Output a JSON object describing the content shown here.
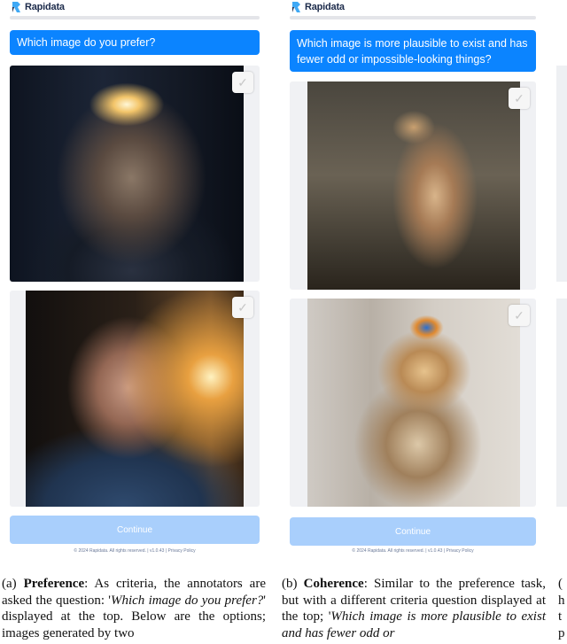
{
  "panel_a": {
    "logo_text": "Rapidata",
    "question": "Which image do you prefer?",
    "continue_label": "Continue",
    "footer": "© 2024 Rapidata. All rights reserved. | v1.0.43 | Privacy Policy"
  },
  "panel_b": {
    "logo_text": "Rapidata",
    "question": "Which image is more plausible to exist and has fewer odd or impossible-looking things?",
    "continue_label": "Continue",
    "footer": "© 2024 Rapidata. All rights reserved. | v1.0.43 | Privacy Policy"
  },
  "caption_a": {
    "label": "(a)",
    "title": "Preference",
    "text1": ": As criteria, the annotators are asked the question: '",
    "italic": "Which image do you prefer?",
    "text2": "' displayed at the top. Below are the options; images generated by two"
  },
  "caption_b": {
    "label": "(b)",
    "title": "Coherence",
    "text1": ": Similar to the preference task, but with a different criteria question displayed at the top; '",
    "italic": "Which image is more plausible to exist and has fewer odd or"
  },
  "caption_c_fragment": "( h t p",
  "colors": {
    "question_bg": "#0b84ff",
    "continue_bg": "#a9cffc",
    "topbar": "#e4e5e9"
  }
}
